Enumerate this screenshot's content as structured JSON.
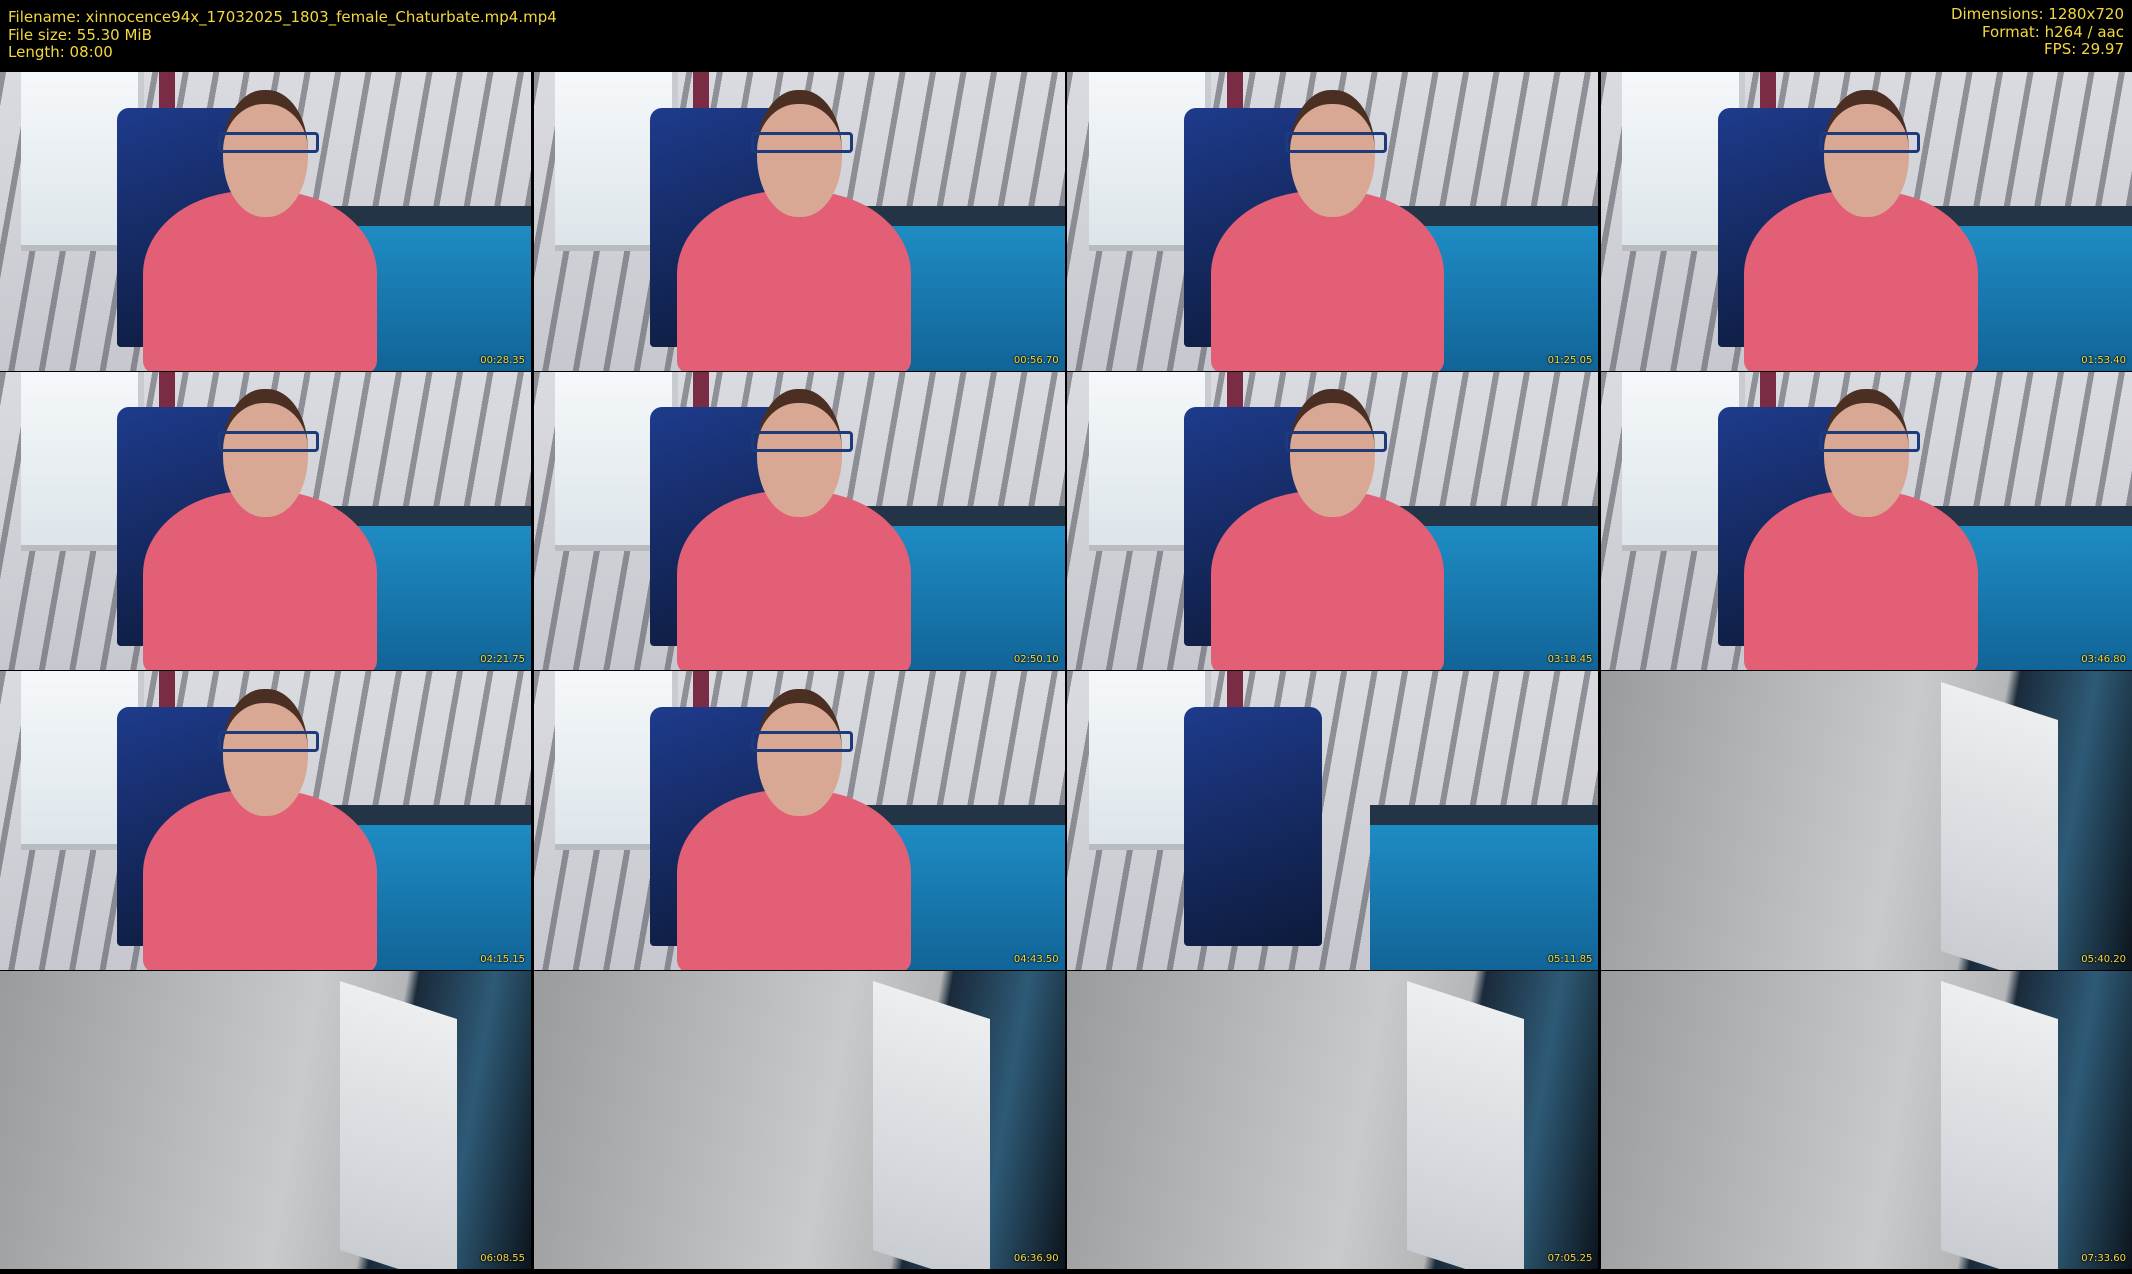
{
  "header": {
    "filename": "Filename: xinnocence94x_17032025_1803_female_Chaturbate.mp4.mp4",
    "filesize": "File size: 55.30 MiB",
    "length": "Length: 08:00",
    "dimensions": "Dimensions: 1280x720",
    "format": "Format: h264 / aac",
    "fps": "FPS: 29.97"
  },
  "thumbnails": [
    {
      "scene": "person",
      "timestamp": "00:28.35"
    },
    {
      "scene": "person",
      "timestamp": "00:56.70"
    },
    {
      "scene": "person",
      "timestamp": "01:25.05"
    },
    {
      "scene": "person",
      "timestamp": "01:53.40"
    },
    {
      "scene": "person",
      "timestamp": "02:21.75"
    },
    {
      "scene": "person",
      "timestamp": "02:50.10"
    },
    {
      "scene": "person",
      "timestamp": "03:18.45"
    },
    {
      "scene": "person",
      "timestamp": "03:46.80"
    },
    {
      "scene": "person",
      "timestamp": "04:15.15"
    },
    {
      "scene": "person",
      "timestamp": "04:43.50"
    },
    {
      "scene": "room",
      "timestamp": "05:11.85"
    },
    {
      "scene": "wall",
      "timestamp": "05:40.20"
    },
    {
      "scene": "wall",
      "timestamp": "06:08.55"
    },
    {
      "scene": "wall",
      "timestamp": "06:36.90"
    },
    {
      "scene": "wall",
      "timestamp": "07:05.25"
    },
    {
      "scene": "wall",
      "timestamp": "07:33.60"
    }
  ]
}
